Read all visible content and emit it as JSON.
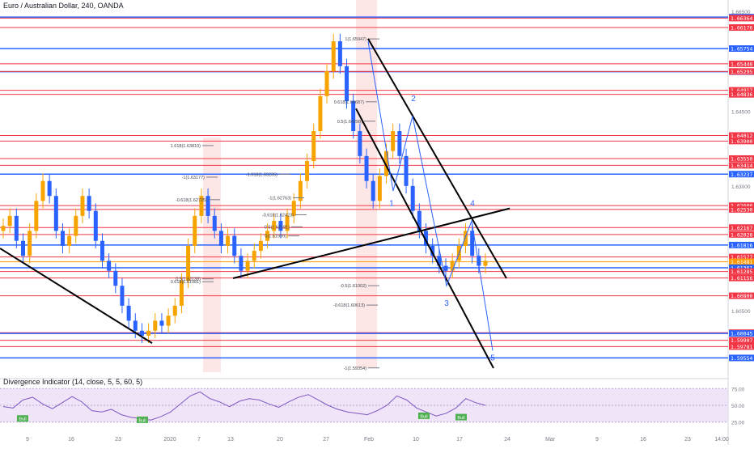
{
  "header": {
    "symbol_title": "Euro / Australian Dollar, 240, OANDA"
  },
  "indicator": {
    "title": "Divergence Indicator (14, close, 5, 5, 60, 5)",
    "levels": [
      75.0,
      50.0,
      25.0
    ],
    "level_labels": [
      "75.00",
      "50.00",
      "25.00"
    ]
  },
  "chart_data": {
    "type": "candlestick",
    "x_ticks": [
      "9",
      "16",
      "23",
      "2020",
      "7",
      "13",
      "20",
      "27",
      "Feb",
      "10",
      "17",
      "24",
      "Mar",
      "9",
      "16",
      "23",
      "14:00"
    ],
    "price_axis_labels": [
      "1.66500",
      "1.64500",
      "1.63000",
      "1.60500"
    ],
    "ylim": [
      1.5935,
      1.665
    ],
    "horizontal_levels": [
      {
        "price": 1.66384,
        "label": "1.66384",
        "color": "#2962ff"
      },
      {
        "price": 1.66364,
        "label": "1.66364",
        "color": "#f23645"
      },
      {
        "price": 1.66176,
        "label": "1.66176",
        "color": "#f23645"
      },
      {
        "price": 1.65754,
        "label": "1.65754",
        "color": "#2962ff"
      },
      {
        "price": 1.65448,
        "label": "1.65448",
        "color": "#f23645"
      },
      {
        "price": 1.65291,
        "label": "1.65291",
        "color": "#2962ff"
      },
      {
        "price": 1.65295,
        "label": "1.65295",
        "color": "#f23645"
      },
      {
        "price": 1.64917,
        "label": "1.64917",
        "color": "#f23645"
      },
      {
        "price": 1.64836,
        "label": "1.64836",
        "color": "#f23645"
      },
      {
        "price": 1.64012,
        "label": "1.64012",
        "color": "#f23645"
      },
      {
        "price": 1.639,
        "label": "1.63900",
        "color": "#f23645"
      },
      {
        "price": 1.6355,
        "label": "1.63550",
        "color": "#f23645"
      },
      {
        "price": 1.63414,
        "label": "1.63414",
        "color": "#f23645"
      },
      {
        "price": 1.63237,
        "label": "1.63237",
        "color": "#2962ff"
      },
      {
        "price": 1.62606,
        "label": "1.62606",
        "color": "#f23645"
      },
      {
        "price": 1.6253,
        "label": "1.62530",
        "color": "#f23645"
      },
      {
        "price": 1.62167,
        "label": "1.62167",
        "color": "#f23645"
      },
      {
        "price": 1.62028,
        "label": "1.62028",
        "color": "#f23645"
      },
      {
        "price": 1.61816,
        "label": "1.61816",
        "color": "#2962ff"
      },
      {
        "price": 1.61577,
        "label": "1.61577",
        "color": "#f23645"
      },
      {
        "price": 1.61481,
        "label": "1.61481",
        "color": "#ff9800"
      },
      {
        "price": 1.61361,
        "label": "1.61361",
        "color": "#2962ff"
      },
      {
        "price": 1.61285,
        "label": "1.61285",
        "color": "#f23645"
      },
      {
        "price": 1.61156,
        "label": "1.61156",
        "color": "#f23645"
      },
      {
        "price": 1.608,
        "label": "1.60800",
        "color": "#f23645"
      },
      {
        "price": 1.6006,
        "label": "1.60060",
        "color": "#f23645"
      },
      {
        "price": 1.60045,
        "label": "1.60045",
        "color": "#2962ff"
      },
      {
        "price": 1.59907,
        "label": "1.59907",
        "color": "#f23645"
      },
      {
        "price": 1.59781,
        "label": "1.59781",
        "color": "#f23645"
      },
      {
        "price": 1.59554,
        "label": "1.59554",
        "color": "#2962ff"
      }
    ],
    "price_series": [
      1.622,
      1.624,
      1.619,
      1.616,
      1.621,
      1.627,
      1.631,
      1.628,
      1.621,
      1.618,
      1.62,
      1.624,
      1.628,
      1.625,
      1.619,
      1.615,
      1.613,
      1.61,
      1.606,
      1.603,
      1.601,
      1.6,
      1.601,
      1.603,
      1.602,
      1.604,
      1.606,
      1.611,
      1.618,
      1.624,
      1.628,
      1.624,
      1.621,
      1.618,
      1.62,
      1.616,
      1.613,
      1.615,
      1.617,
      1.619,
      1.621,
      1.623,
      1.621,
      1.624,
      1.627,
      1.631,
      1.635,
      1.641,
      1.648,
      1.653,
      1.659,
      1.654,
      1.647,
      1.641,
      1.636,
      1.631,
      1.627,
      1.632,
      1.637,
      1.641,
      1.636,
      1.63,
      1.625,
      1.621,
      1.618,
      1.616,
      1.614,
      1.613,
      1.615,
      1.618,
      1.621,
      1.616,
      1.614,
      1.615
    ],
    "fib_levels": [
      {
        "label": "1(1.65947)",
        "price": 1.65947
      },
      {
        "label": "0.618(1.64687)",
        "price": 1.64687
      },
      {
        "label": "0.5(1.64298)",
        "price": 1.64298
      },
      {
        "label": "-1.618(1.63235)",
        "price": 1.63235
      },
      {
        "label": "-1(1.62763)",
        "price": 1.62763
      },
      {
        "label": "-0.618(1.62423)",
        "price": 1.62423
      },
      {
        "label": "0.5(1.62181)",
        "price": 1.62181
      },
      {
        "label": "0(1.61999)",
        "price": 1.61999
      },
      {
        "label": "-0.5(1.61002)",
        "price": 1.61002
      },
      {
        "label": "-0.618(1.60613)",
        "price": 1.60613
      },
      {
        "label": "-1(1.59354)",
        "price": 1.59354
      },
      {
        "label": "1.618(1.63810)",
        "price": 1.6381
      },
      {
        "label": "-1(1.63177)",
        "price": 1.63177
      },
      {
        "label": "-0.618(1.62725)",
        "price": 1.62725
      },
      {
        "label": "0.5(1.61138)",
        "price": 1.61138
      },
      {
        "label": "0.618(1.61081)",
        "price": 1.61081
      }
    ],
    "wave_labels": [
      "1",
      "2",
      "3",
      "4",
      "5"
    ],
    "oscillator_series": [
      48,
      46,
      58,
      62,
      52,
      45,
      54,
      63,
      55,
      42,
      40,
      44,
      36,
      32,
      30,
      28,
      33,
      40,
      52,
      64,
      70,
      60,
      55,
      48,
      56,
      60,
      58,
      52,
      47,
      55,
      62,
      66,
      58,
      50,
      44,
      40,
      38,
      36,
      42,
      50,
      64,
      58,
      46,
      40,
      34,
      38,
      46,
      60,
      54,
      50
    ],
    "divergence_markers": [
      "Bull",
      "Bull",
      "Bull",
      "Bull"
    ]
  },
  "colors": {
    "bull_candle": "#f7a400",
    "bear_candle": "#2962ff",
    "support_level": "#2962ff",
    "resistance_level": "#f23645",
    "current_price": "#ff9800",
    "oscillator_line": "#7e57c2",
    "oscillator_band": "#e9d8f5"
  }
}
